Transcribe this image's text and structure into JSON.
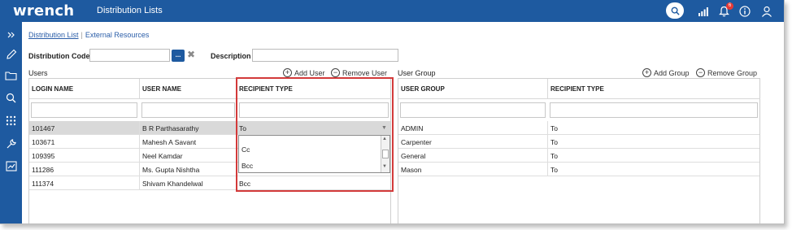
{
  "topbar": {
    "logo": "wrench",
    "title": "Distribution Lists",
    "notification_count": "6"
  },
  "nav": {
    "link_active": "Distribution List",
    "link_other": "External Resources"
  },
  "form": {
    "code_label": "Distribution Code",
    "code_value": "",
    "lookup_label": "...",
    "description_label": "Description",
    "description_value": ""
  },
  "users": {
    "title": "Users",
    "add_label": "Add User",
    "remove_label": "Remove User",
    "columns": [
      "LOGIN NAME",
      "USER NAME",
      "RECIPIENT TYPE"
    ],
    "rows": [
      {
        "login": "101467",
        "name": "B R Parthasarathy",
        "type": "To"
      },
      {
        "login": "103671",
        "name": "Mahesh A Savant",
        "type": ""
      },
      {
        "login": "109395",
        "name": "Neel Kamdar",
        "type": ""
      },
      {
        "login": "111286",
        "name": "Ms. Gupta Nishtha",
        "type": ""
      },
      {
        "login": "111374",
        "name": "Shivam Khandelwal",
        "type": "Bcc"
      }
    ],
    "dropdown_options": [
      "Cc",
      "Bcc"
    ]
  },
  "groups": {
    "title": "User Group",
    "add_label": "Add Group",
    "remove_label": "Remove Group",
    "columns": [
      "USER GROUP",
      "RECIPIENT TYPE"
    ],
    "rows": [
      {
        "group": "ADMIN",
        "type": "To"
      },
      {
        "group": "Carpenter",
        "type": "To"
      },
      {
        "group": "General",
        "type": "To"
      },
      {
        "group": "Mason",
        "type": "To"
      }
    ]
  },
  "colors": {
    "brand": "#1e5aa0",
    "highlight": "#d33a3a"
  }
}
